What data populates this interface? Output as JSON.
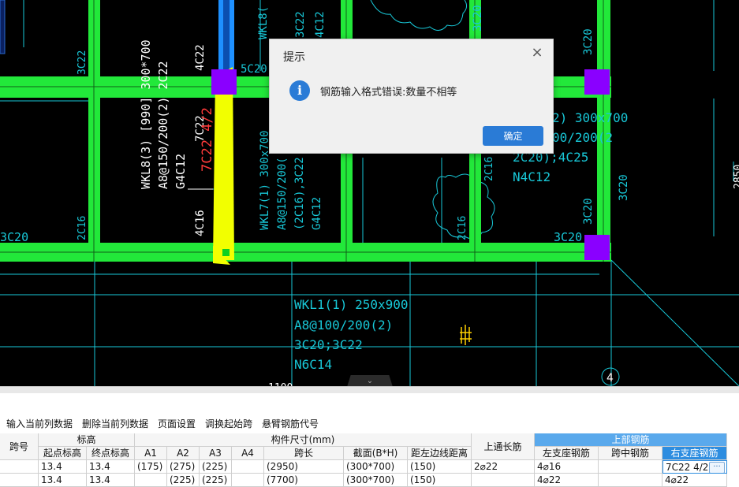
{
  "dialog": {
    "title": "提示",
    "message": "钢筋输入格式错误:数量不相等",
    "ok_label": "确定",
    "close_glyph": "×",
    "info_glyph": "i"
  },
  "canvas": {
    "labels": {
      "wkl8_1": "WKL8(3) [990] 300*700",
      "wkl8_2": "A8@150/200(2) 2C22",
      "wkl8_3": "G4C12",
      "top_4c22": "4C22",
      "mid_7c22": "7C22",
      "red_7c22": "7C22 4/2",
      "bot_4c16": "4C16",
      "wkl7_1": "WKL7(1) 300x700",
      "wkl7_2": "A8@150/200(",
      "wkl7_3": "(2C16),3C22",
      "wkl7_4": "G4C12",
      "wkl1_1": "WKL1(1) 250x900",
      "wkl1_2": "A8@100/200(2)",
      "wkl1_3": "3C20;3C22",
      "wkl1_4": "N6C14",
      "right_1": "2) 300x700",
      "right_2": "00/200(2",
      "right_3": "2C20);4C25",
      "right_4": "N4C12",
      "left_3c22": "3C22",
      "left_3c20": "3C20",
      "left_2c16": "2C16",
      "mid_2c16": "2C16",
      "mid2_2c16": "2C16",
      "top_5c20": "5C20",
      "top_wkl8": "WKL8(",
      "top_3c22": "3C22",
      "top_4c12": "4C12",
      "r_3c20a": "3C20",
      "r_3c20b": "3C20",
      "r_3c20c": "3C20",
      "r_3c20d": "3C20",
      "r_3c20e": "3C20",
      "r_2c22": "2C22",
      "axis_num": "4",
      "far_right": "2850",
      "bottom_cut": "1100"
    }
  },
  "collapse_glyph": "⌄",
  "toolbar": {
    "items": [
      "输入当前列数据",
      "删除当前列数据",
      "页面设置",
      "调换起始跨",
      "悬臂钢筋代号"
    ]
  },
  "table": {
    "headers": {
      "span_no": "跨号",
      "elevation": "标高",
      "start_elev": "起点标高",
      "end_elev": "终点标高",
      "dims": "构件尺寸(mm)",
      "a1": "A1",
      "a2": "A2",
      "a3": "A3",
      "a4": "A4",
      "span_len": "跨长",
      "section": "截面(B*H)",
      "dist_left": "距左边线距离",
      "top_through": "上通长筋",
      "top_rebar": "上部钢筋",
      "left_support": "左支座钢筋",
      "mid_span": "跨中钢筋",
      "right_support": "右支座钢筋"
    },
    "rows": [
      {
        "start": "13.4",
        "end": "13.4",
        "a1": "(175)",
        "a2": "(275)",
        "a3": "(225)",
        "a4": "",
        "span": "(2950)",
        "section": "(300*700)",
        "dist": "(150)",
        "through": "2⌀22",
        "left": "4⌀16",
        "mid": "",
        "right": "7C22 4/2"
      },
      {
        "start": "13.4",
        "end": "13.4",
        "a1": "",
        "a2": "(225)",
        "a3": "(225)",
        "a4": "",
        "span": "(7700)",
        "section": "(300*700)",
        "dist": "(150)",
        "through": "",
        "left": "4⌀22",
        "mid": "",
        "right": "4⌀22"
      }
    ],
    "ellipsis": "···"
  },
  "colors": {
    "beam_green": "#22e83a",
    "column_purple": "#8a00ff",
    "cad_cyan": "#18c8d8",
    "selected_yellow": "#f2ff00",
    "dialog_accent": "#2a7bd6"
  }
}
